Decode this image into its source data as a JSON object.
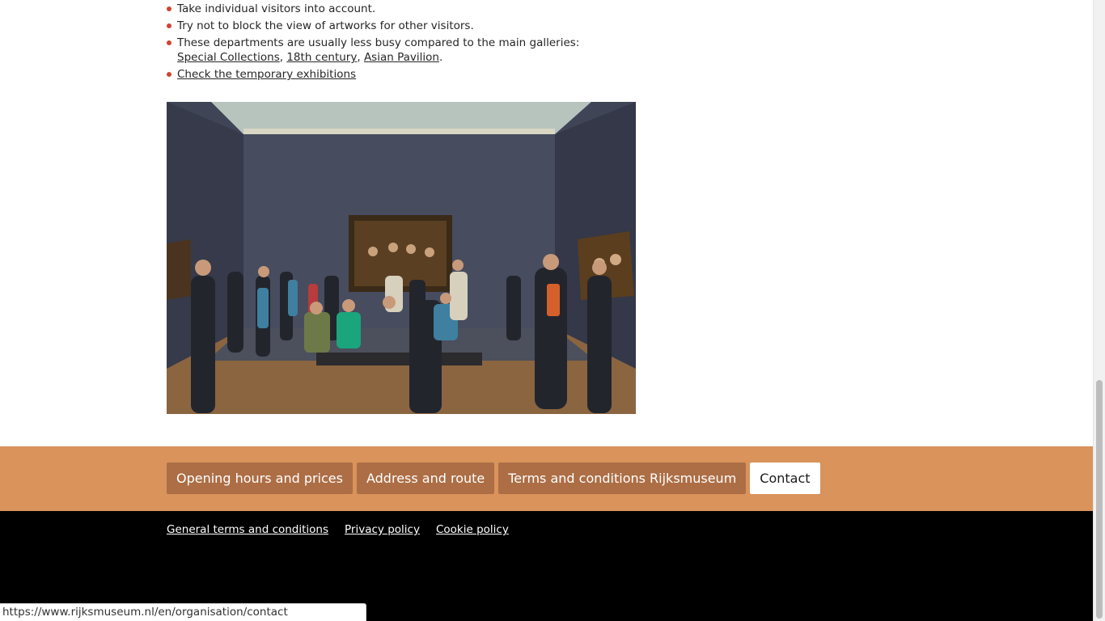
{
  "tips": {
    "item1": "Take individual visitors into account.",
    "item2": "Try not to block the view of artworks for other visitors.",
    "item3_prefix": "These departments are usually less busy compared to the main galleries: ",
    "item3_links": [
      "Special Collections",
      "18th century",
      "Asian Pavilion"
    ],
    "item3_suffix": ".",
    "item4_link": "Check the temporary exhibitions"
  },
  "photo": {
    "description_icon": "gallery-photo"
  },
  "footer_nav": {
    "buttons": [
      "Opening hours and prices",
      "Address and route",
      "Terms and conditions Rijksmuseum",
      "Contact"
    ],
    "active_index": 3
  },
  "footer_legal": {
    "links": [
      "General terms and conditions ",
      "Privacy policy ",
      "Cookie policy"
    ]
  },
  "status": {
    "url": "https://www.rijksmuseum.nl/en/organisation/contact"
  },
  "colors": {
    "bullet": "#d0432f",
    "footer_band": "#d9935b",
    "footer_button": "#ad6e45",
    "footer_legal_bg": "#000000"
  }
}
